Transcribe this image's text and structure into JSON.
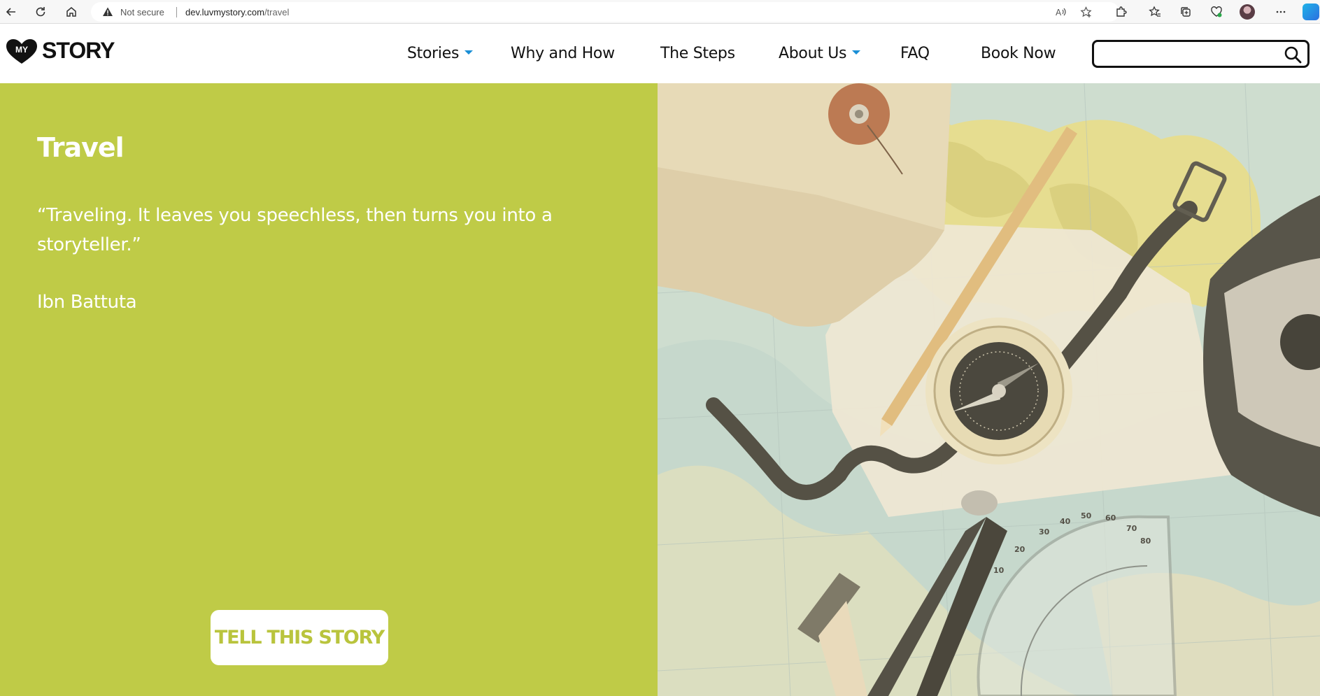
{
  "browser": {
    "security_label": "Not secure",
    "url_host": "dev.luvmystory.com",
    "url_path": "/travel",
    "icons": [
      "back-icon",
      "refresh-icon",
      "home-icon",
      "warning-icon",
      "read-aloud-icon",
      "add-favorite-icon",
      "extensions-icon",
      "favorites-icon",
      "collections-icon",
      "browser-essentials-icon",
      "profile-avatar",
      "more-icon",
      "bing-icon"
    ]
  },
  "header": {
    "logo_badge": "MY",
    "logo_text": "STORY",
    "nav": {
      "stories": "Stories",
      "why_and_how": "Why and How",
      "the_steps": "The Steps",
      "about_us": "About Us",
      "faq": "FAQ",
      "book_now": "Book Now"
    },
    "search": {
      "placeholder": "",
      "value": ""
    }
  },
  "hero": {
    "title": "Travel",
    "quote": "“Traveling. It leaves you speechless, then turns you into a storyteller.”",
    "author": "Ibn Battuta",
    "cta_label": "TELL THIS STORY",
    "image_subject": "travel map with compass, pencil, protractor and camera"
  },
  "colors": {
    "accent_green": "#bfcb47",
    "nav_caret_blue": "#1a8fd6",
    "cta_text": "#b9c43d"
  }
}
